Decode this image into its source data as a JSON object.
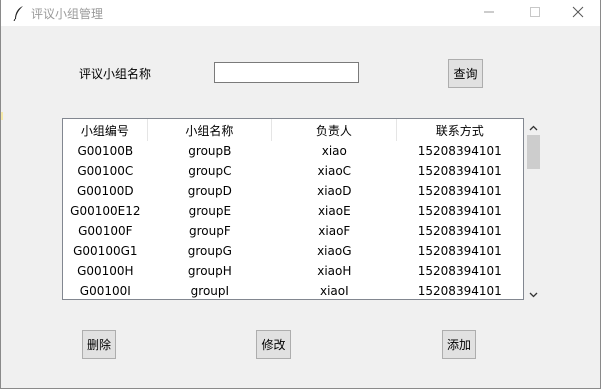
{
  "window": {
    "title": "评议小组管理",
    "icon": "feather-icon"
  },
  "form": {
    "name_label": "评议小组名称",
    "name_value": "",
    "query_button": "查询"
  },
  "table": {
    "columns": [
      "小组编号",
      "小组名称",
      "负责人",
      "联系方式"
    ],
    "rows": [
      [
        "G00100B",
        "groupB",
        "xiao",
        "15208394101"
      ],
      [
        "G00100C",
        "groupC",
        "xiaoC",
        "15208394101"
      ],
      [
        "G00100D",
        "groupD",
        "xiaoD",
        "15208394101"
      ],
      [
        "G00100E12",
        "groupE",
        "xiaoE",
        "15208394101"
      ],
      [
        "G00100F",
        "groupF",
        "xiaoF",
        "15208394101"
      ],
      [
        "G00100G1",
        "groupG",
        "xiaoG",
        "15208394101"
      ],
      [
        "G00100H",
        "groupH",
        "xiaoH",
        "15208394101"
      ],
      [
        "G00100I",
        "groupI",
        "xiaoI",
        "15208394101"
      ]
    ]
  },
  "actions": {
    "delete": "删除",
    "edit": "修改",
    "add": "添加"
  }
}
